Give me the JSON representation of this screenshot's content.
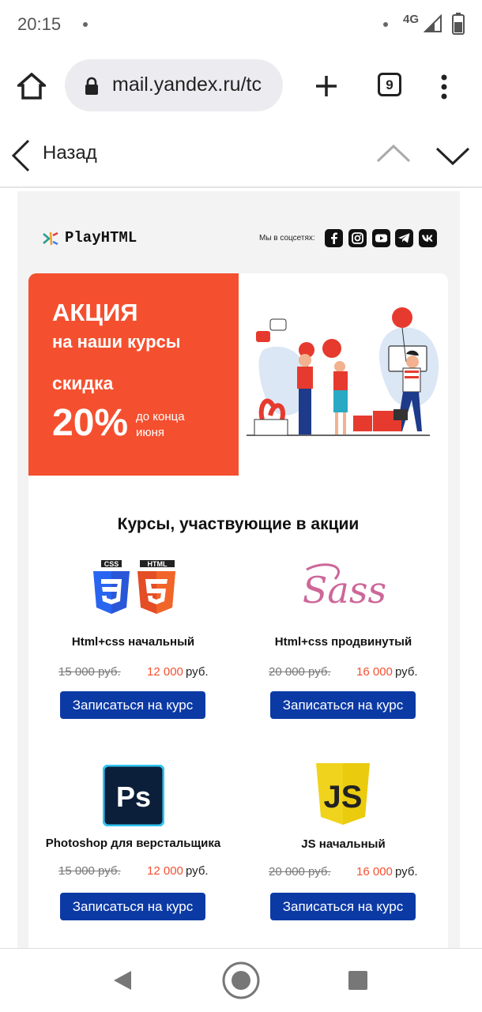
{
  "status_bar": {
    "time": "20:15",
    "network": "4G",
    "icons": [
      "notification-dot-icon",
      "signal-icon",
      "battery-icon"
    ]
  },
  "browser": {
    "url": "mail.yandex.ru/tc",
    "tabs_count": "9",
    "icons": [
      "home-icon",
      "lock-icon",
      "new-tab-icon",
      "menu-icon"
    ]
  },
  "mail_nav": {
    "back_label": "Назад",
    "icons": [
      "chevron-left-icon",
      "chevron-up-icon",
      "chevron-down-icon"
    ]
  },
  "email": {
    "brand": {
      "name": "PlayHTML"
    },
    "social": {
      "label": "Мы в соцсетях:",
      "icons": [
        "facebook-icon",
        "instagram-icon",
        "youtube-icon",
        "telegram-icon",
        "vk-icon"
      ]
    },
    "promo": {
      "title": "АКЦИЯ",
      "subtitle": "на наши курсы",
      "discount_label": "скидка",
      "percent": "20%",
      "until": "до конца июня",
      "accent": "#f4502f"
    },
    "section_title": "Курсы, участвующие в акции",
    "courses": [
      {
        "name": "Html+css начальный",
        "old_price": "15 000 руб.",
        "new_price": "12 000",
        "currency": "руб.",
        "button": "Записаться на курс",
        "icon": "css-html-icon",
        "css_label": "CSS",
        "html_label": "HTML"
      },
      {
        "name": "Html+css продвинутый",
        "old_price": "20 000 руб.",
        "new_price": "16 000",
        "currency": "руб.",
        "button": "Записаться на курс",
        "icon": "sass-icon",
        "logo_text": "Sass"
      },
      {
        "name": "Photoshop для верстальщика",
        "old_price": "15 000 руб.",
        "new_price": "12 000",
        "currency": "руб.",
        "button": "Записаться на курс",
        "icon": "photoshop-icon",
        "logo_text": "Ps"
      },
      {
        "name": "JS начальный",
        "old_price": "20 000 руб.",
        "new_price": "16 000",
        "currency": "руб.",
        "button": "Записаться на курс",
        "icon": "js-icon",
        "logo_text": "JS"
      }
    ],
    "button_color": "#0c3aa5"
  },
  "system_nav": {
    "icons": [
      "back-triangle-icon",
      "home-circle-icon",
      "recents-square-icon"
    ]
  }
}
